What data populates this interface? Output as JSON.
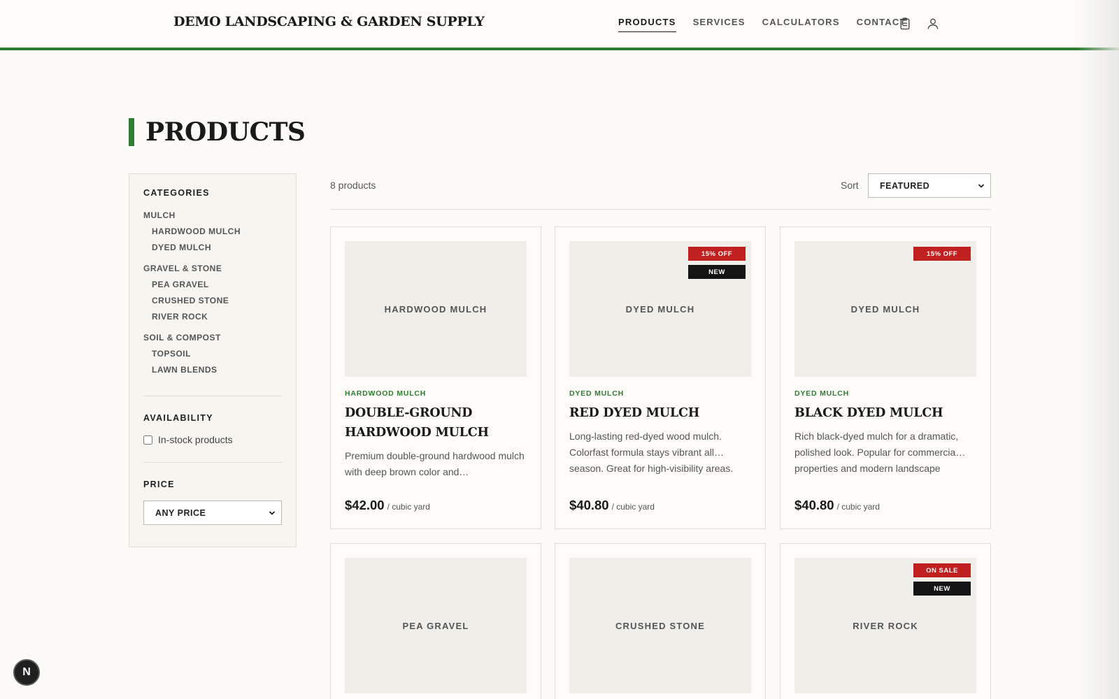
{
  "header": {
    "brand": "DEMO LANDSCAPING & GARDEN SUPPLY",
    "nav": [
      {
        "label": "PRODUCTS",
        "active": true
      },
      {
        "label": "SERVICES",
        "active": false
      },
      {
        "label": "CALCULATORS",
        "active": false
      },
      {
        "label": "CONTACT",
        "active": false
      }
    ],
    "icons": [
      "clipboard-icon",
      "user-icon"
    ]
  },
  "page": {
    "title": "PRODUCTS"
  },
  "sidebar": {
    "categories_heading": "CATEGORIES",
    "categories": [
      {
        "label": "MULCH",
        "children": [
          "HARDWOOD MULCH",
          "DYED MULCH"
        ]
      },
      {
        "label": "GRAVEL & STONE",
        "children": [
          "PEA GRAVEL",
          "CRUSHED STONE",
          "RIVER ROCK"
        ]
      },
      {
        "label": "SOIL & COMPOST",
        "children": [
          "TOPSOIL",
          "LAWN BLENDS"
        ]
      }
    ],
    "availability_heading": "AVAILABILITY",
    "in_stock_label": "In-stock products",
    "in_stock_checked": false,
    "price_heading": "PRICE",
    "price_selected": "ANY PRICE"
  },
  "toolbar": {
    "count": "8 products",
    "sort_label": "Sort",
    "sort_selected": "FEATURED"
  },
  "products": [
    {
      "image_label": "HARDWOOD MULCH",
      "badges": [],
      "category": "HARDWOOD MULCH",
      "name": "DOUBLE-GROUND HARDWOOD MULCH",
      "description": "Premium double-ground hardwood mulch with deep brown color and…",
      "price": "$42.00",
      "unit": "/ cubic yard"
    },
    {
      "image_label": "DYED MULCH",
      "badges": [
        {
          "text": "15% OFF",
          "style": "red"
        },
        {
          "text": "NEW",
          "style": "black"
        }
      ],
      "category": "DYED MULCH",
      "name": "RED DYED MULCH",
      "description": "Long-lasting red-dyed wood mulch. Colorfast formula stays vibrant all… season. Great for high-visibility areas.",
      "price": "$40.80",
      "unit": "/ cubic yard"
    },
    {
      "image_label": "DYED MULCH",
      "badges": [
        {
          "text": "15% OFF",
          "style": "red"
        }
      ],
      "category": "DYED MULCH",
      "name": "BLACK DYED MULCH",
      "description": "Rich black-dyed mulch for a dramatic, polished look. Popular for commercia… properties and modern landscape",
      "price": "$40.80",
      "unit": "/ cubic yard"
    },
    {
      "image_label": "PEA GRAVEL",
      "badges": []
    },
    {
      "image_label": "CRUSHED STONE",
      "badges": []
    },
    {
      "image_label": "RIVER ROCK",
      "badges": [
        {
          "text": "ON SALE",
          "style": "red"
        },
        {
          "text": "NEW",
          "style": "black"
        }
      ]
    }
  ],
  "colors": {
    "accent": "#2e7d32",
    "badge_red": "#c0201f",
    "badge_black": "#141414"
  },
  "dev_badge": "N"
}
